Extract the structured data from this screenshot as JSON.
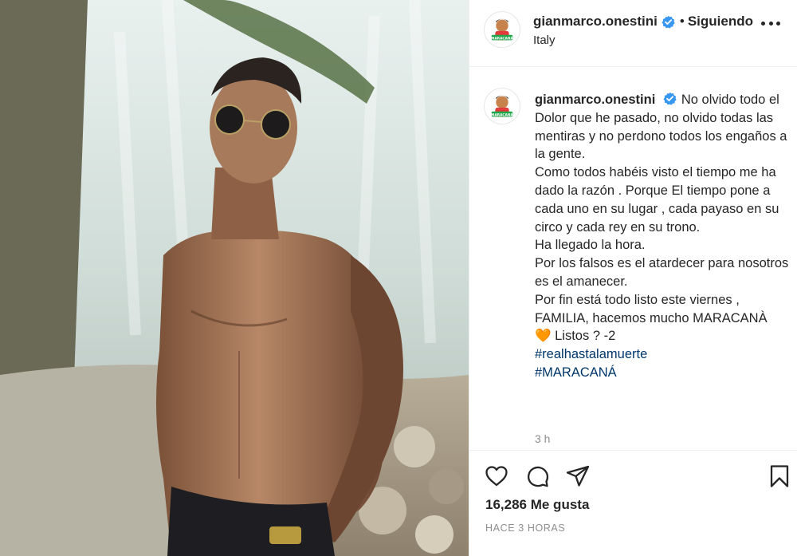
{
  "post": {
    "image_description_icon": "post-photo",
    "header": {
      "username": "gianmarco.onestini",
      "verified_icon": "verified-badge-icon",
      "separator": "•",
      "follow_status": "Siguiendo",
      "location": "Italy",
      "more_icon": "more-options-icon",
      "avatar_text": "MARACANÁ"
    },
    "caption": {
      "username": "gianmarco.onestini",
      "first_line": "No olvido todo el",
      "lines": [
        "Dolor que he pasado, no olvido todas las mentiras y no perdono todos los engaños a la gente.",
        "Como todos habéis visto el tiempo me ha dado la razón . Porque El tiempo pone a cada uno en su lugar , cada payaso en su circo y cada rey en su trono.",
        "Ha llegado la hora.",
        "Por los falsos es el atardecer para nosotros es el amanecer.",
        "Por fin está todo listo este viernes , FAMILIA, hacemos mucho MARACANÀ"
      ],
      "last_line_emoji": "🧡",
      "last_line_text": " Listos ? -2",
      "hashtags": [
        "#realhastalamuerte",
        "#MARACANÁ"
      ],
      "time": "3 h"
    },
    "actions": {
      "like_icon": "heart-icon",
      "comment_icon": "comment-icon",
      "share_icon": "share-icon",
      "save_icon": "bookmark-icon"
    },
    "likes": "16,286 Me gusta",
    "posted": "HACE 3 HORAS"
  },
  "colors": {
    "text": "#262626",
    "muted": "#8e8e8e",
    "hashtag": "#00376b",
    "verified": "#3897f0",
    "border": "#efefef"
  }
}
